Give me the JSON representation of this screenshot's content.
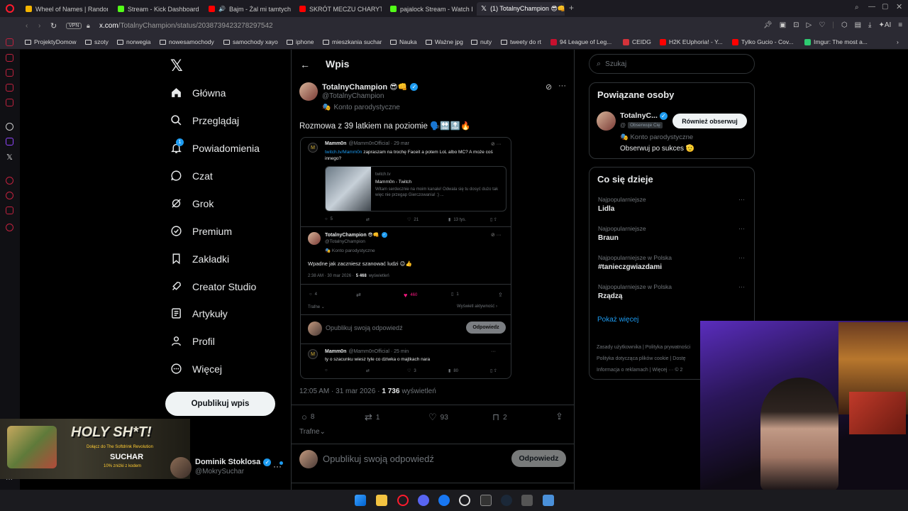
{
  "browser": {
    "tabs": [
      {
        "title": "Wheel of Names | Random",
        "color": "#f4b400"
      },
      {
        "title": "Stream - Kick Dashboard",
        "color": "#53fc18"
      },
      {
        "title": "Bajm - Żal mi tamtych",
        "color": "#ff0000"
      },
      {
        "title": "SKRÓT MECZU CHARYTA",
        "color": "#ff0000"
      },
      {
        "title": "pajalock Stream - Watch L",
        "color": "#53fc18"
      },
      {
        "title": "(1) TotalnyChampion 😎👊",
        "color": "#ffffff"
      }
    ],
    "vpn_label": "VPN",
    "url_host": "x.com",
    "url_path": "/TotalnyChampion/status/2038739423278297542",
    "ai_label": "AI",
    "bookmarks": [
      "ProjektyDomow",
      "szoty",
      "norwegia",
      "nowesamochody",
      "samochody xayo",
      "iphone",
      "mieszkania suchar",
      "Nauka",
      "Ważne jpg",
      "nuty",
      "tweety do rt",
      "94 League of Leg...",
      "CEIDG",
      "H2K EUphoria! - Y...",
      "Tylko Gucio - Cov...",
      "Imgur: The most a..."
    ]
  },
  "nav": {
    "items": [
      "Główna",
      "Przeglądaj",
      "Powiadomienia",
      "Czat",
      "Grok",
      "Premium",
      "Zakładki",
      "Creator Studio",
      "Artykuły",
      "Profil",
      "Więcej"
    ],
    "notification_badge": "1",
    "post_button": "Opublikuj wpis",
    "account_name": "Dominik Stoklosa",
    "account_handle": "@MokrySuchar"
  },
  "main": {
    "header_title": "Wpis",
    "author_name": "TotalnyChampion 😎👊",
    "author_handle": "@TotalnyChampion",
    "author_label": "Konto parodystyczne",
    "post_text": "Rozmowa z 39 latkiem na poziomie 🗣️🔛🔝🔥",
    "embed": {
      "q_name": "Mamm0n",
      "q_handle": "@Mamm0nOfficial · 29 mar",
      "q_link": "twitch.tv/Mamm0n",
      "q_text": "zapraszam na trochę Faceit a potem LoL albo MC? A może coś innego?",
      "card_domain": "twitch.tv",
      "card_title": "Mamm0n - Twitch",
      "card_desc": "Witam serdecznie na moim kanale! Odwala się tu dosyć dużo tak więc nie przegap Gierczowania! :) ...",
      "q_stats": [
        "5",
        "",
        "21",
        "13 tys."
      ],
      "r_name": "TotalnyChampion 😎👊",
      "r_handle": "@TotalnyChampion",
      "r_label": "Konto parodystyczne",
      "r_text": "Wpadne jak zaczniesz szanować ludzi 😉👍",
      "r_time": "2:38 AM · 30 mar 2026 ·",
      "r_views": "5 468",
      "r_views_label": "wyświetleń",
      "r_stats": [
        "4",
        "",
        "460",
        "1"
      ],
      "r_sort": "Trafne",
      "r_activity": "Wyświetl aktywność",
      "reply_placeholder": "Opublikuj swoją odpowiedź",
      "reply_btn": "Odpowiedz",
      "m_name": "Mamm0n",
      "m_handle": "@Mamm0nOfficial · 25 min",
      "m_text": "ty o szacunku wiesz tyle co dziwka o majtkach nara",
      "m_stats": [
        "",
        "",
        "3",
        "80"
      ]
    },
    "post_time": "12:05 AM · 31 mar 2026 ·",
    "views": "1 736",
    "views_label": "wyświetleń",
    "stats": {
      "replies": "8",
      "reposts": "1",
      "likes": "93",
      "bookmarks": "2"
    },
    "sort_label": "Trafne",
    "reply_placeholder": "Opublikuj swoją odpowiedź",
    "reply_button": "Odpowiedz"
  },
  "sidebar": {
    "search_placeholder": "Szukaj",
    "related_title": "Powiązane osoby",
    "related_name": "TotalnyC...",
    "related_handle": "@",
    "follows_you": "Obserwuje Cię",
    "follow_back": "Również obserwuj",
    "related_label": "Konto parodystyczne",
    "related_bio": "Obserwuj po sukces 🫡",
    "trending_title": "Co się dzieje",
    "trends": [
      {
        "context": "Najpopularniejsze",
        "name": "Lidla"
      },
      {
        "context": "Najpopularniejsze",
        "name": "Braun"
      },
      {
        "context": "Najpopularniejsze w Polska",
        "name": "#tanieczgwiazdami"
      },
      {
        "context": "Najpopularniejsze w Polska",
        "name": "Rządzą"
      }
    ],
    "show_more": "Pokaż więcej",
    "footer": [
      "Zasady użytkownika",
      "Polityka prywatności",
      "Polityka dotycząca plików cookie",
      "Dostę",
      "Informacja o reklamach",
      "Więcej ···",
      "© 2"
    ]
  },
  "overlay": {
    "holy": "HOLY SH*T!",
    "promo": "Dołącz do The Softdrink Revolution",
    "brand": "SUCHAR",
    "code": "10% zniżki z kodem"
  }
}
